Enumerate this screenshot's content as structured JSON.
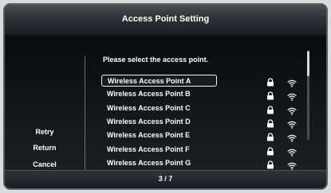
{
  "window": {
    "title": "Access Point Setting"
  },
  "side_menu": {
    "retry": "Retry",
    "return": "Return",
    "cancel": "Cancel"
  },
  "prompt": "Please select the access point.",
  "access_points": [
    {
      "name": "Wireless Access Point A",
      "selected": true
    },
    {
      "name": "Wireless Access Point B"
    },
    {
      "name": "Wireless Access Point C"
    },
    {
      "name": "Wireless Access Point D"
    },
    {
      "name": "Wireless Access Point E"
    },
    {
      "name": "Wireless Access Point F"
    },
    {
      "name": "Wireless Access Point G"
    }
  ],
  "icons": {
    "security": "lock-icon",
    "signal": "wifi-icon"
  },
  "footer": {
    "page": "3 / 7"
  }
}
